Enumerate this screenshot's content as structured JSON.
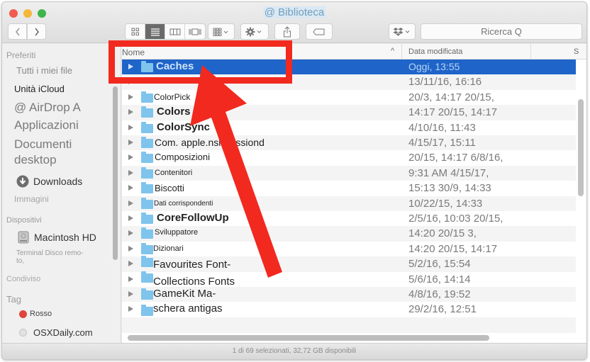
{
  "window": {
    "title": "@ Biblioteca",
    "traffic_lights": {
      "close": "#f05a50",
      "minimize": "#f5b73a",
      "maximize": "#3cb54a"
    }
  },
  "toolbar": {
    "back_icon": "chevron-left-icon",
    "forward_icon": "chevron-right-icon",
    "view_modes": [
      "icon-view",
      "list-view",
      "column-view",
      "coverflow-view"
    ],
    "active_view": "list-view",
    "arrange_icon": "arrange-grid-icon",
    "action_icon": "gear-icon",
    "share_icon": "share-icon",
    "tag_icon": "tag-icon",
    "dropbox_icon": "dropbox-icon",
    "search_placeholder": "Ricerca Q"
  },
  "sidebar": {
    "sections": [
      {
        "title": "Preferiti",
        "items": [
          {
            "label": "Tutti i miei file",
            "icon": null
          },
          {
            "label": "Unità iCloud",
            "icon": null
          },
          {
            "label": "@ AirDrop A",
            "icon": null
          },
          {
            "label": "Applicazioni",
            "icon": null
          },
          {
            "label": "Documenti",
            "icon": null
          },
          {
            "label": "desktop",
            "icon": null
          },
          {
            "label": "Downloads",
            "icon": "download-icon"
          },
          {
            "label": "Immagini",
            "icon": null
          }
        ]
      },
      {
        "title": "Dispositivi",
        "items": [
          {
            "label": "Macintosh HD",
            "icon": "hard-drive-icon"
          },
          {
            "label": "Terminal Disco remo-",
            "icon": null
          },
          {
            "label": "to,",
            "icon": null
          }
        ]
      },
      {
        "title": "Condiviso",
        "items": []
      },
      {
        "title": "Tag",
        "items": [
          {
            "label": "Rosso",
            "icon": "tag-dot-icon",
            "color": "#e0453c"
          },
          {
            "label": "OSXDaily.com",
            "icon": "tag-dot-icon",
            "color": "#d8d8d8"
          }
        ]
      }
    ]
  },
  "file_list": {
    "columns": {
      "name": "Nome",
      "date": "Data modificata",
      "size": "S"
    },
    "sort_indicator": "^",
    "selected_color": "#1f64c8",
    "rows": [
      {
        "name": "Caches",
        "date": "Oggi, 13:55",
        "selected": true
      },
      {
        "name": "",
        "date": "13/11/16, 16:16"
      },
      {
        "name": "ColorPick",
        "date": "20/3, 14:17 20/15,"
      },
      {
        "name": "Colors",
        "date": "14:17 20/15, 14:17"
      },
      {
        "name": "ColorSync",
        "date": "4/10/16, 11:43"
      },
      {
        "name": "Com. apple.nsl    Sessiond",
        "date": "4/15/17, 15:11"
      },
      {
        "name": "Composizioni",
        "date": "20/15, 14:17 6/8/16,"
      },
      {
        "name": "Contenitori",
        "date": "9:31 AM 4/15/17,"
      },
      {
        "name": "Biscotti",
        "date": "15:13 30/9, 14:33"
      },
      {
        "name": "Dati corrispondenti",
        "date": "10/22/15, 14:33"
      },
      {
        "name": "CoreFollowUp",
        "date": "2/5/16, 10:03 20/15,"
      },
      {
        "name": "Sviluppatore",
        "date": "14:20 20/15 3,"
      },
      {
        "name": "Dizionari",
        "date": "14:20 20/15, 14:17"
      },
      {
        "name": "Favourites Font-",
        "date": "5/2/16, 15:54"
      },
      {
        "name": "Collections Fonts",
        "date": "5/6/16, 14:14"
      },
      {
        "name": "GameKit Ma-",
        "date": "4/8/16, 19:52"
      },
      {
        "name": "schera antigas",
        "date": "29/2/16, 12:51"
      }
    ]
  },
  "status_bar": {
    "text": "1 di 69 selezionati, 32,72 GB disponibili"
  },
  "annotation": {
    "color": "#f2291f",
    "type": "highlight-box-and-arrow",
    "target": "Caches"
  }
}
